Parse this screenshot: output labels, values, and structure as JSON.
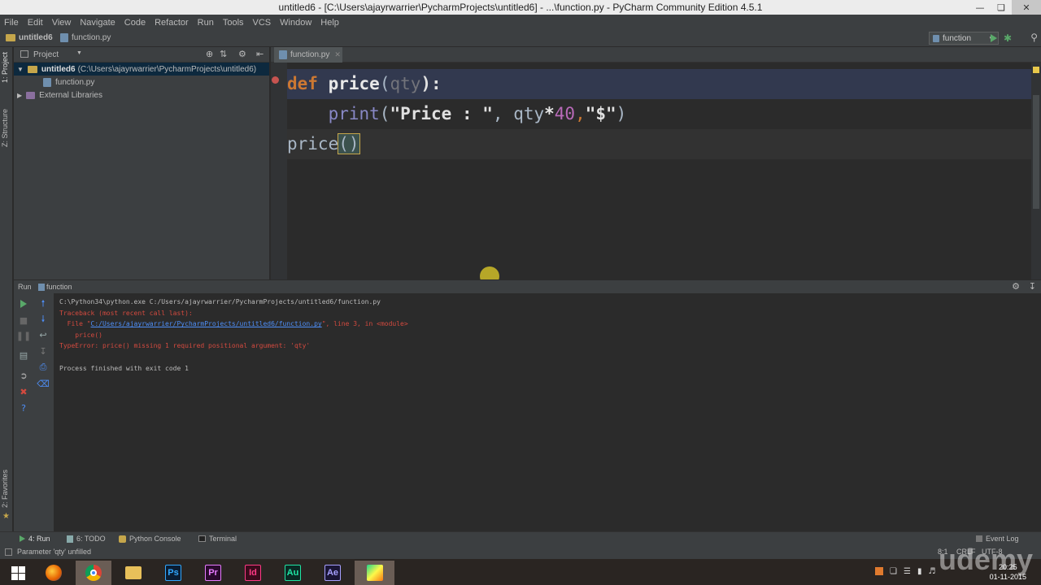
{
  "window": {
    "title": "untitled6 - [C:\\Users\\ajayrwarrier\\PycharmProjects\\untitled6] - ...\\function.py - PyCharm Community Edition 4.5.1",
    "controls": [
      "minimize-icon",
      "maximize-icon",
      "close-icon"
    ]
  },
  "menu": [
    "File",
    "Edit",
    "View",
    "Navigate",
    "Code",
    "Refactor",
    "Run",
    "Tools",
    "VCS",
    "Window",
    "Help"
  ],
  "navbar": {
    "crumbs": [
      "untitled6",
      "function.py"
    ],
    "run_config": "function"
  },
  "left_strip": {
    "project_tab": "1: Project",
    "structure_tab": "Z: Structure",
    "favorites_tab": "2: Favorites"
  },
  "project_panel": {
    "title": "Project",
    "root": "untitled6",
    "root_path": "(C:\\Users\\ajayrwarrier\\PycharmProjects\\untitled6)",
    "file": "function.py",
    "external": "External Libraries"
  },
  "editor": {
    "tab": "function.py",
    "code": {
      "l1": {
        "kw": "def",
        "sp": " ",
        "name": "price",
        "open": "(",
        "param": "qty",
        "close": "):"
      },
      "l2": {
        "indent": "    ",
        "fn": "print",
        "open": "(",
        "str1": "\"Price : \"",
        "comma1": ", ",
        "var": "qty",
        "op": "*",
        "num": "40",
        "comma2": ",",
        "str2": "\"$\"",
        "close": ")"
      },
      "l3": {
        "call": "price",
        "parens": "()"
      }
    }
  },
  "run": {
    "label": "Run",
    "config": "function",
    "console": {
      "cmd": "C:\\Python34\\python.exe C:/Users/ajayrwarrier/PycharmProjects/untitled6/function.py",
      "traceback": "Traceback (most recent call last):",
      "file_prefix": "  File \"",
      "file_link": "C:/Users/ajayrwarrier/PycharmProjects/untitled6/function.py",
      "file_suffix": "\", line 3, in <module>",
      "call": "    price()",
      "error": "TypeError: price() missing 1 required positional argument: 'qty'",
      "exit": "Process finished with exit code 1"
    }
  },
  "bottom_tabs": {
    "run": "4: Run",
    "todo": "6: TODO",
    "python_console": "Python Console",
    "terminal": "Terminal",
    "event_log": "Event Log"
  },
  "status": {
    "message": "Parameter 'qty' unfilled",
    "position": "8:1",
    "line_sep": "CRLF",
    "encoding": "UTF-8"
  },
  "taskbar": {
    "apps": [
      {
        "name": "windows-start",
        "label": ""
      },
      {
        "name": "firefox",
        "label": ""
      },
      {
        "name": "chrome",
        "label": ""
      },
      {
        "name": "file-explorer",
        "label": ""
      },
      {
        "name": "photoshop",
        "label": "Ps"
      },
      {
        "name": "premiere",
        "label": "Pr"
      },
      {
        "name": "indesign",
        "label": "Id"
      },
      {
        "name": "audition",
        "label": "Au"
      },
      {
        "name": "after-effects",
        "label": "Ae"
      },
      {
        "name": "pycharm",
        "label": ""
      }
    ],
    "time": "20:25",
    "date": "01-11-2015"
  },
  "watermark": "udemy",
  "colors": {
    "keyword": "#cc7832",
    "function_name": "#ffc66d",
    "string": "#6a8759",
    "number": "#b86ab8",
    "error": "#d34a3f",
    "editor_bg": "#2b2b2b",
    "panel_bg": "#3c3f41"
  }
}
